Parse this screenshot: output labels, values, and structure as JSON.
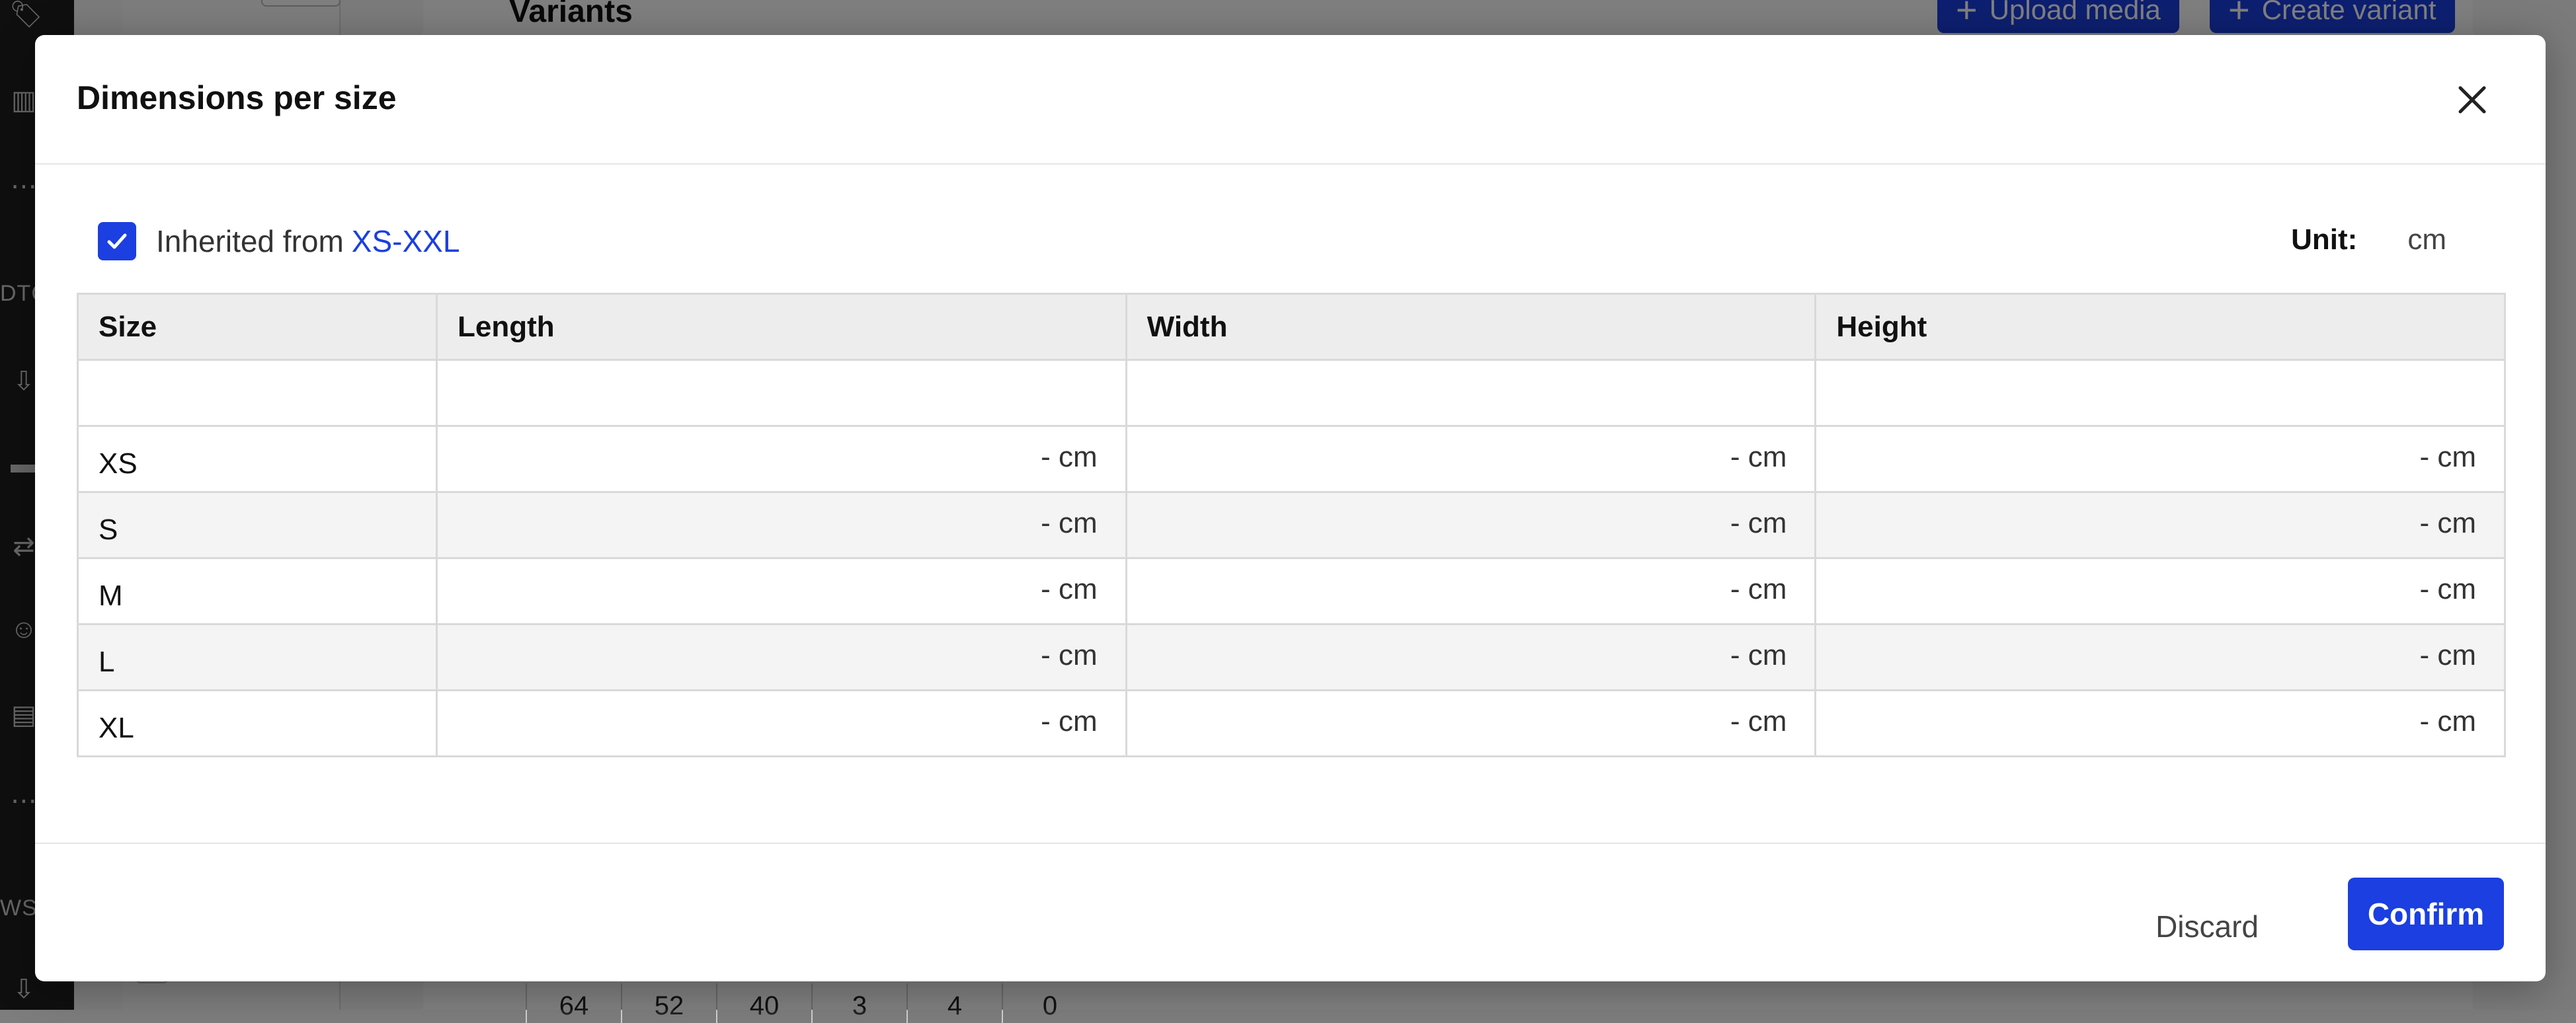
{
  "background": {
    "section_title": "Variants",
    "upload_button": "Upload media",
    "create_button": "Create variant",
    "sidebar_texts": [
      "DTC",
      "WS"
    ],
    "bottom_cells": [
      "64",
      "52",
      "40",
      "3",
      "4",
      "0"
    ]
  },
  "modal": {
    "title": "Dimensions per size",
    "inherit": {
      "checked": true,
      "label": "Inherited from",
      "link_text": "XS-XXL"
    },
    "unit": {
      "label": "Unit:",
      "value": "cm"
    },
    "table": {
      "headers": [
        "Size",
        "Length",
        "Width",
        "Height"
      ],
      "rows": [
        {
          "size": "",
          "length": "",
          "width": "",
          "height": ""
        },
        {
          "size": "XS",
          "length": "- cm",
          "width": "- cm",
          "height": "- cm"
        },
        {
          "size": "S",
          "length": "- cm",
          "width": "- cm",
          "height": "- cm"
        },
        {
          "size": "M",
          "length": "- cm",
          "width": "- cm",
          "height": "- cm"
        },
        {
          "size": "L",
          "length": "- cm",
          "width": "- cm",
          "height": "- cm"
        },
        {
          "size": "XL",
          "length": "- cm",
          "width": "- cm",
          "height": "- cm"
        }
      ]
    },
    "footer": {
      "discard_label": "Discard",
      "confirm_label": "Confirm"
    }
  },
  "colors": {
    "accent": "#1b3fe0",
    "header_bg": "#ededed",
    "alt_row_bg": "#f4f4f4"
  }
}
